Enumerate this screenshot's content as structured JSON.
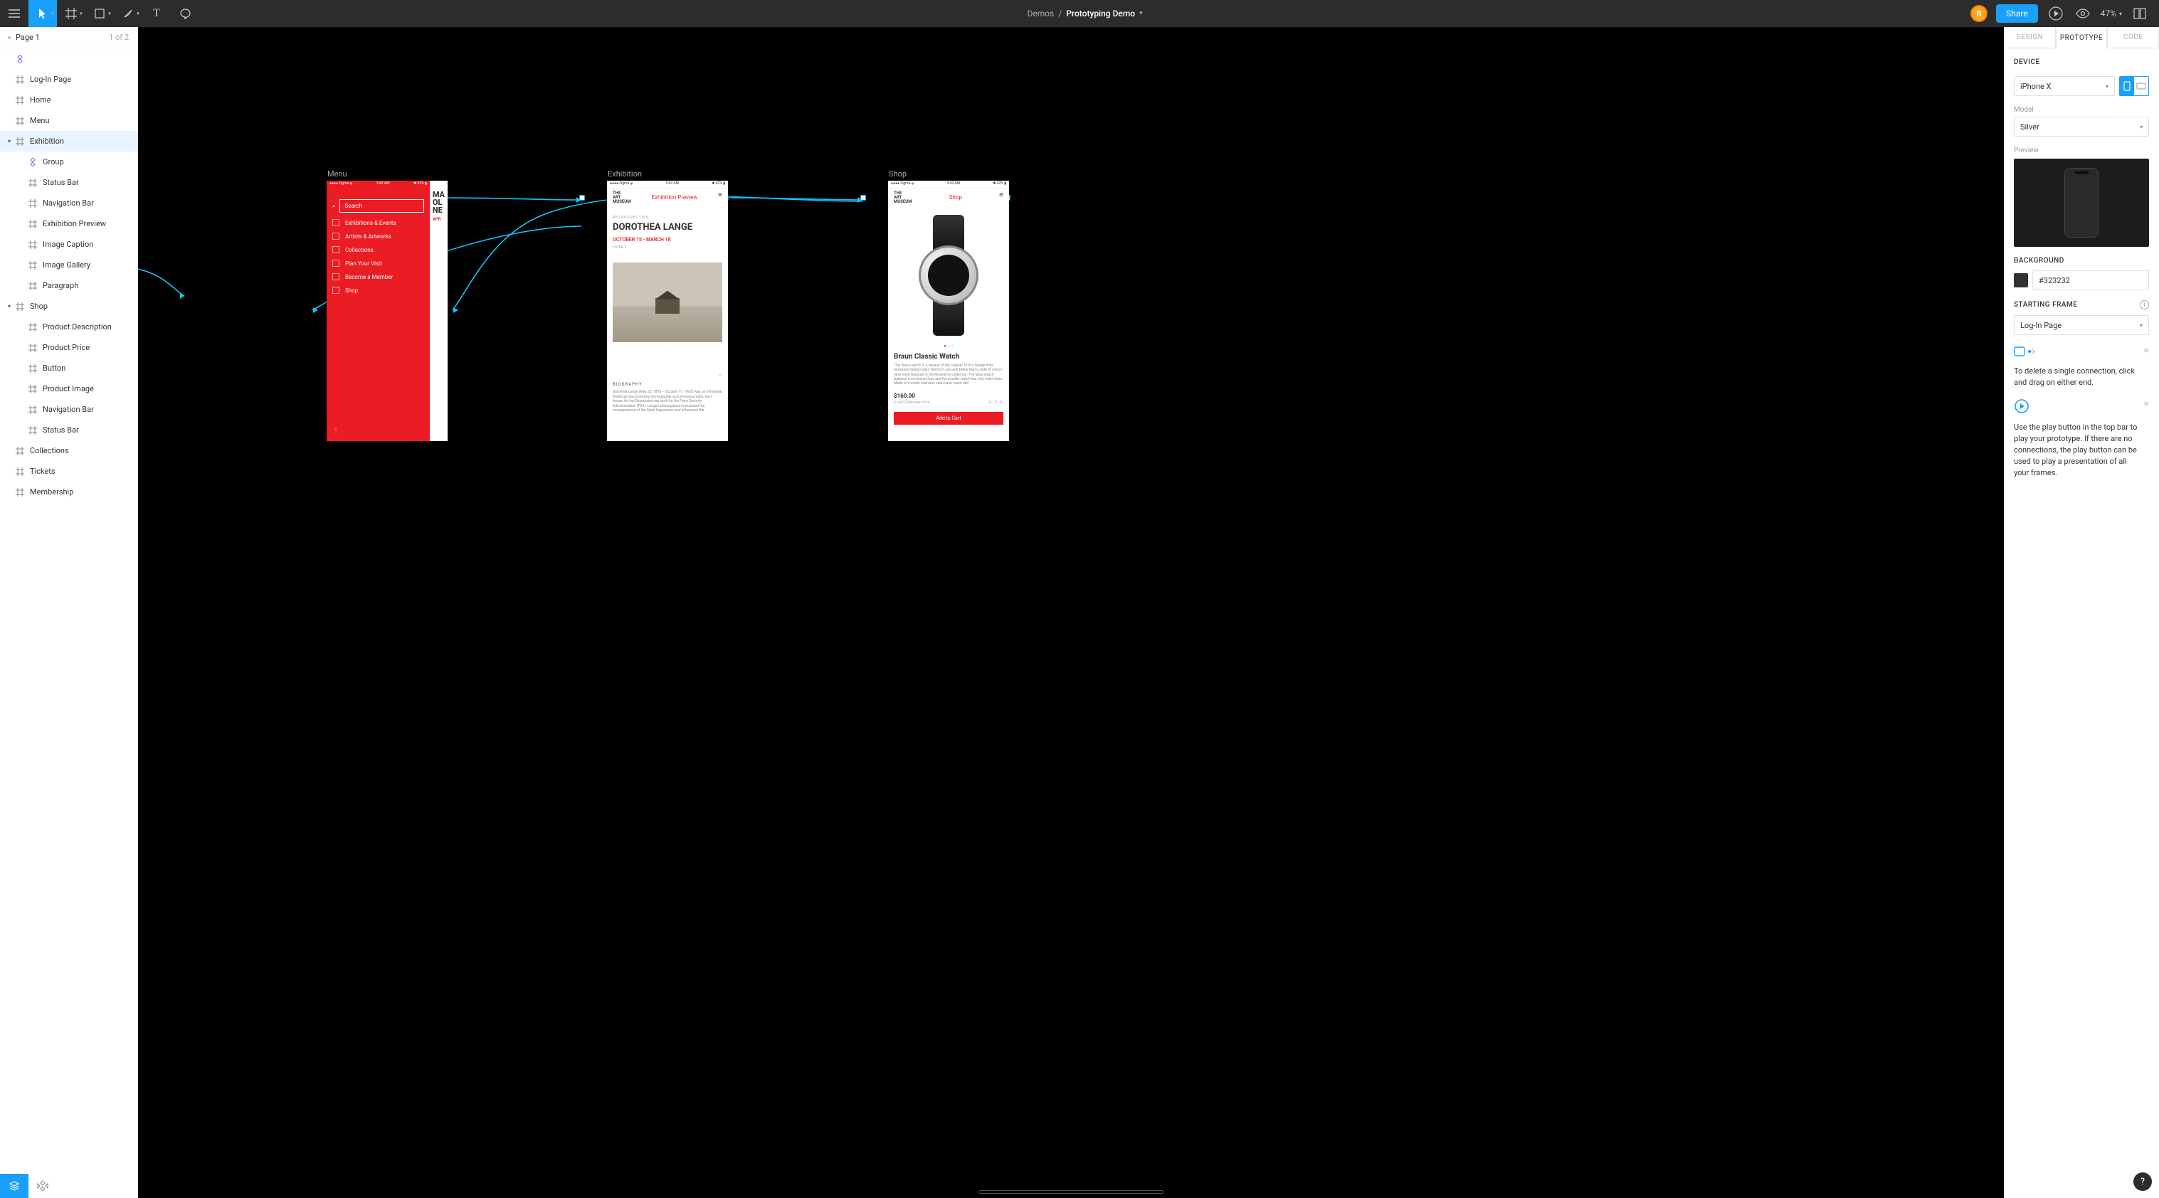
{
  "topbar": {
    "breadcrumb_folder": "Demos",
    "breadcrumb_sep": "/",
    "breadcrumb_file": "Prototyping Demo",
    "avatar_initial": "R",
    "share_label": "Share",
    "zoom_label": "47%"
  },
  "pages": {
    "current_label": "Page 1",
    "counter": "1 of 2"
  },
  "layers": [
    {
      "depth": 0,
      "type": "component",
      "label": "",
      "caret": ""
    },
    {
      "depth": 0,
      "type": "frame",
      "label": "Log-In Page",
      "caret": ""
    },
    {
      "depth": 0,
      "type": "frame",
      "label": "Home",
      "caret": ""
    },
    {
      "depth": 0,
      "type": "frame",
      "label": "Menu",
      "caret": ""
    },
    {
      "depth": 0,
      "type": "frame",
      "label": "Exhibition",
      "caret": "▾",
      "selected": true
    },
    {
      "depth": 1,
      "type": "component",
      "label": "Group",
      "caret": ""
    },
    {
      "depth": 1,
      "type": "frame",
      "label": "Status Bar",
      "caret": ""
    },
    {
      "depth": 1,
      "type": "frame",
      "label": "Navigation Bar",
      "caret": ""
    },
    {
      "depth": 1,
      "type": "frame",
      "label": "Exhibition Preview",
      "caret": ""
    },
    {
      "depth": 1,
      "type": "frame",
      "label": "Image Caption",
      "caret": ""
    },
    {
      "depth": 1,
      "type": "frame",
      "label": "Image Gallery",
      "caret": ""
    },
    {
      "depth": 1,
      "type": "frame",
      "label": "Paragraph",
      "caret": ""
    },
    {
      "depth": 0,
      "type": "frame",
      "label": "Shop",
      "caret": "▾"
    },
    {
      "depth": 1,
      "type": "frame",
      "label": "Product Description",
      "caret": ""
    },
    {
      "depth": 1,
      "type": "frame",
      "label": "Product Price",
      "caret": ""
    },
    {
      "depth": 1,
      "type": "frame",
      "label": "Button",
      "caret": ""
    },
    {
      "depth": 1,
      "type": "frame",
      "label": "Product Image",
      "caret": ""
    },
    {
      "depth": 1,
      "type": "frame",
      "label": "Navigation Bar",
      "caret": ""
    },
    {
      "depth": 1,
      "type": "frame",
      "label": "Status Bar",
      "caret": ""
    },
    {
      "depth": 0,
      "type": "frame",
      "label": "Collections",
      "caret": ""
    },
    {
      "depth": 0,
      "type": "frame",
      "label": "Tickets",
      "caret": ""
    },
    {
      "depth": 0,
      "type": "frame",
      "label": "Membership",
      "caret": ""
    }
  ],
  "canvas": {
    "frames": {
      "menu": {
        "label": "Menu"
      },
      "exhibition": {
        "label": "Exhibition"
      },
      "shop": {
        "label": "Shop"
      }
    },
    "status_bar": {
      "carrier": "Figma",
      "time": "9:42 AM",
      "battery": "42%"
    },
    "menu_panel": {
      "search_label": "Search",
      "items": [
        "Exhibitions & Events",
        "Artists & Artworks",
        "Collections",
        "Plan Your Visit",
        "Become a Member",
        "Shop"
      ],
      "peek_title": "MA\nOL\nNE",
      "peek_sub": "APR"
    },
    "exhibition_panel": {
      "logo": "THE\nART\nMUSEUM",
      "preview_label": "Exhibition Preview",
      "retro": "RETROSPECTIVE",
      "name": "DOROTHEA LANGE",
      "dates": "OCTOBER 15 - MARCH 18",
      "floor": "FLOOR 3",
      "bio_h": "BIOGRAPHY",
      "bio": "Dorothea Lange (May 26, 1895 – October 11, 1965) was an influential American documentary photographer and photojournalist, best known for her Depression-era work for the Farm Security Administration (FSA). Lange's photographs humanized the consequences of the Great Depression and influenced the"
    },
    "shop_panel": {
      "logo": "THE\nART\nMUSEUM",
      "title": "Shop",
      "product": "Braun Classic Watch",
      "desc": "This Braun watch is a reissue of the original 1970's design from renowned design team Dietrich Lubs and Dieter Rams, both of whom have work featured in the Museum's collection. The large watch features a numbered face and the smaller watch has only index lines. Made of a matte stainless steel case, black dial.",
      "price": "$160.00",
      "member": "$144.00 Member Price",
      "button": "Add to Cart"
    }
  },
  "right": {
    "tabs": {
      "design": "DESIGN",
      "prototype": "PROTOTYPE",
      "code": "CODE"
    },
    "device_h": "DEVICE",
    "device_value": "iPhone X",
    "model_label": "Model",
    "model_value": "Silver",
    "preview_label": "Preview",
    "background_h": "BACKGROUND",
    "background_value": "#323232",
    "starting_h": "STARTING FRAME",
    "starting_value": "Log-In Page",
    "hint1": "To delete a single connection, click and drag on either end.",
    "hint2": "Use the play button in the top bar to play your prototype. If there are no connections, the play button can be used to play a presentation of all your frames."
  }
}
